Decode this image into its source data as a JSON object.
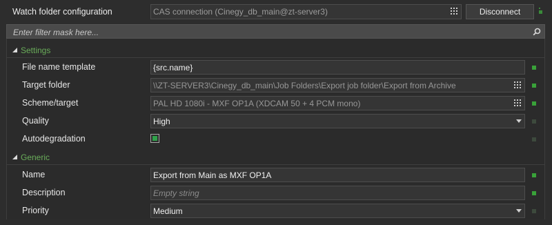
{
  "header": {
    "title": "Watch folder configuration",
    "connection": "CAS connection (Cinegy_db_main@zt-server3)",
    "disconnect_label": "Disconnect"
  },
  "filter": {
    "placeholder": "Enter filter mask here..."
  },
  "sections": {
    "settings": {
      "title": "Settings",
      "rows": {
        "file_name_template": {
          "label": "File name template",
          "value": "{src.name}"
        },
        "target_folder": {
          "label": "Target folder",
          "value": "\\\\ZT-SERVER3\\Cinegy_db_main\\Job Folders\\Export job folder\\Export from Archive"
        },
        "scheme_target": {
          "label": "Scheme/target",
          "value": "PAL HD 1080i - MXF OP1A (XDCAM 50 + 4 PCM mono)"
        },
        "quality": {
          "label": "Quality",
          "value": "High"
        },
        "autodegradation": {
          "label": "Autodegradation",
          "checked": true
        }
      }
    },
    "generic": {
      "title": "Generic",
      "rows": {
        "name": {
          "label": "Name",
          "value": "Export from Main as MXF OP1A"
        },
        "description": {
          "label": "Description",
          "placeholder": "Empty string"
        },
        "priority": {
          "label": "Priority",
          "value": "Medium"
        }
      }
    }
  },
  "colors": {
    "section_title": "#6aad5a",
    "status_active": "#39a239",
    "status_inactive": "#3d4a3d",
    "background": "#2b2b2b"
  },
  "icons": {
    "connection": "grid-icon",
    "filter": "search-icon",
    "collapse": "triangle-expanded-icon"
  }
}
